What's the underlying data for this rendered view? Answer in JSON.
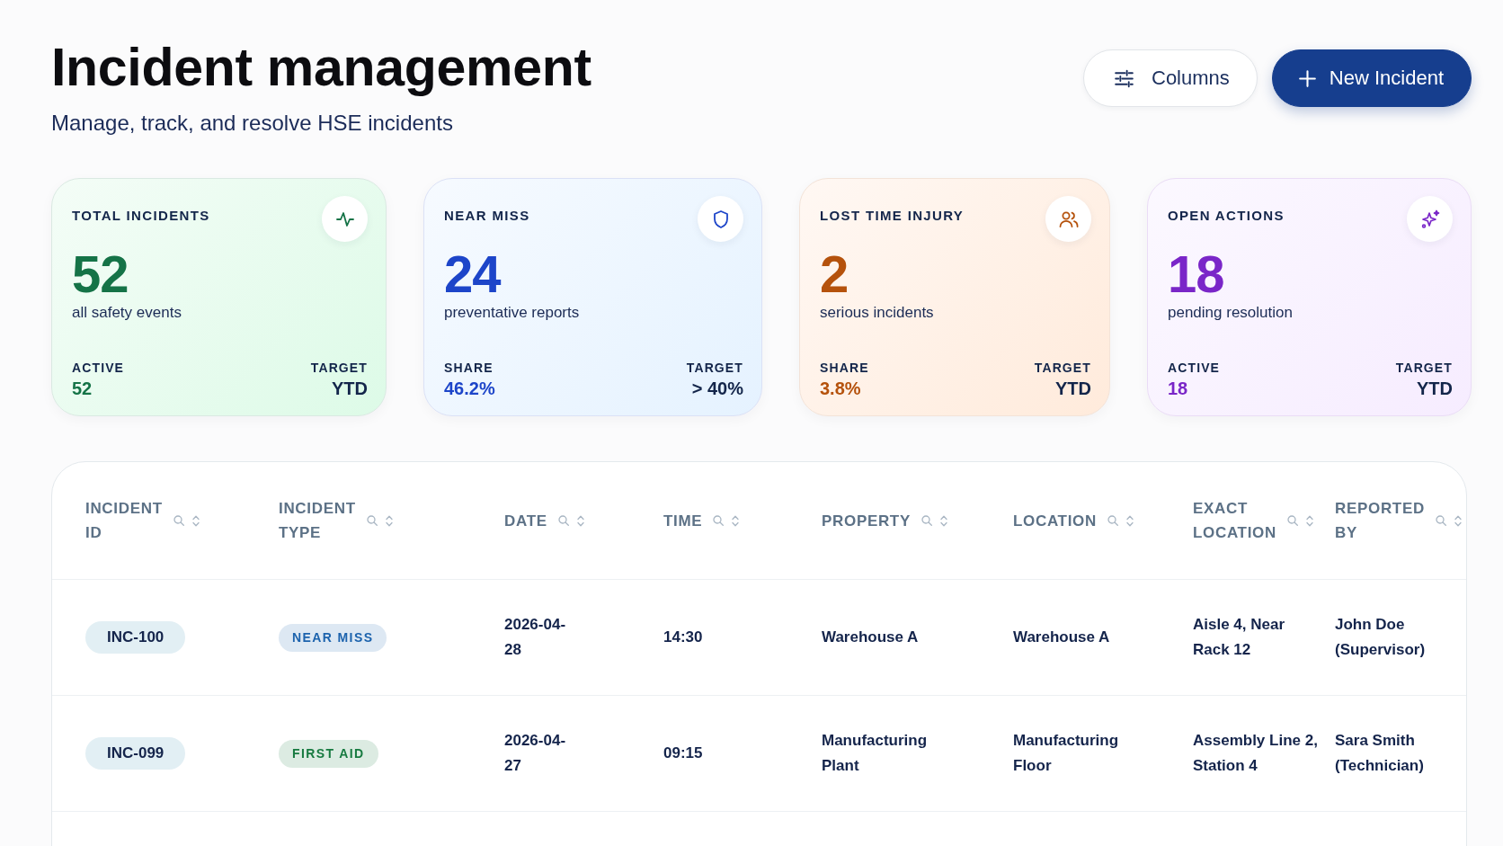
{
  "page": {
    "title": "Incident management",
    "subtitle": "Manage, track, and resolve HSE incidents"
  },
  "actions": [
    {
      "kind": "secondary",
      "label": "Columns"
    },
    {
      "kind": "primary",
      "label": "New Incident"
    }
  ],
  "cards": [
    {
      "label": "TOTAL INCIDENTS",
      "value": "52",
      "note": "all safety events",
      "color": "#157347",
      "stats": [
        {
          "label": "ACTIVE",
          "value": "52"
        },
        {
          "label": "TARGET",
          "value": "YTD"
        }
      ]
    },
    {
      "label": "NEAR MISS",
      "value": "24",
      "note": "preventative reports",
      "color": "#1d45c9",
      "stats": [
        {
          "label": "SHARE",
          "value": "46.2%"
        },
        {
          "label": "TARGET",
          "value": "> 40%"
        }
      ]
    },
    {
      "label": "LOST TIME INJURY",
      "value": "2",
      "note": "serious incidents",
      "color": "#b5520c",
      "stats": [
        {
          "label": "SHARE",
          "value": "3.8%"
        },
        {
          "label": "TARGET",
          "value": "YTD"
        }
      ]
    },
    {
      "label": "OPEN ACTIONS",
      "value": "18",
      "note": "pending resolution",
      "color": "#7a26c8",
      "stats": [
        {
          "label": "ACTIVE",
          "value": "18"
        },
        {
          "label": "TARGET",
          "value": "YTD"
        }
      ]
    }
  ],
  "table": {
    "columns": [
      "INCIDENT ID",
      "INCIDENT TYPE",
      "DATE",
      "TIME",
      "PROPERTY",
      "LOCATION",
      "EXACT LOCATION",
      "REPORTED BY"
    ],
    "rows": [
      {
        "id": "INC-100",
        "type": {
          "label": "NEAR MISS",
          "color": "#1c63ad"
        },
        "date": "2026-04-28",
        "time": "14:30",
        "property": "Warehouse A",
        "location": "Warehouse A",
        "exact_location": "Aisle 4, Near Rack 12",
        "reported_by": "John Doe (Supervisor)"
      },
      {
        "id": "INC-099",
        "type": {
          "label": "FIRST AID",
          "color": "#177a40"
        },
        "date": "2026-04-27",
        "time": "09:15",
        "property": "Manufacturing Plant",
        "location": "Manufacturing Floor",
        "exact_location": "Assembly Line 2, Station 4",
        "reported_by": "Sara Smith (Technician)"
      }
    ]
  }
}
